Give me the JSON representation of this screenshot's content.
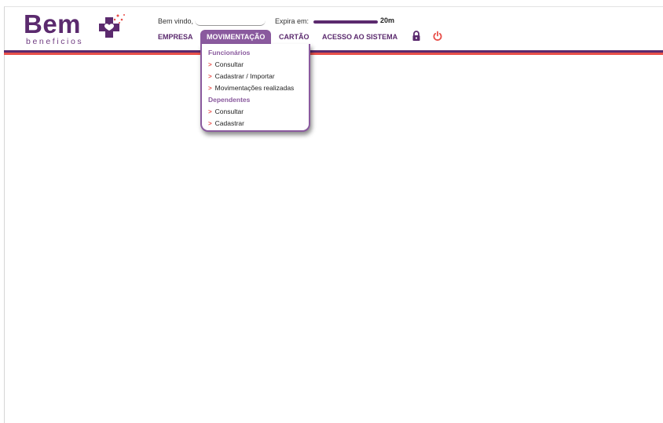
{
  "brand": {
    "name": "Bem",
    "tagline": "beneficios",
    "color_primary": "#5b2a6e",
    "color_accent": "#e8504a"
  },
  "header": {
    "welcome_label": "Bem vindo,",
    "welcome_user": "",
    "expiry_label": "Expira em:",
    "expiry_time": "20m",
    "expiry_progress": 1.0
  },
  "nav": {
    "items": [
      {
        "label": "EMPRESA"
      },
      {
        "label": "MOVIMENTAÇÃO",
        "active": true
      },
      {
        "label": "CARTÃO"
      },
      {
        "label": "ACESSO AO SISTEMA"
      }
    ],
    "lock_icon": "lock-icon",
    "power_icon": "power-icon"
  },
  "dropdown": {
    "sections": [
      {
        "title": "Funcionários",
        "items": [
          "Consultar",
          "Cadastrar / Importar",
          "Movimentações realizadas"
        ]
      },
      {
        "title": "Dependentes",
        "items": [
          "Consultar",
          "Cadastrar"
        ]
      }
    ],
    "bullet": ">"
  }
}
